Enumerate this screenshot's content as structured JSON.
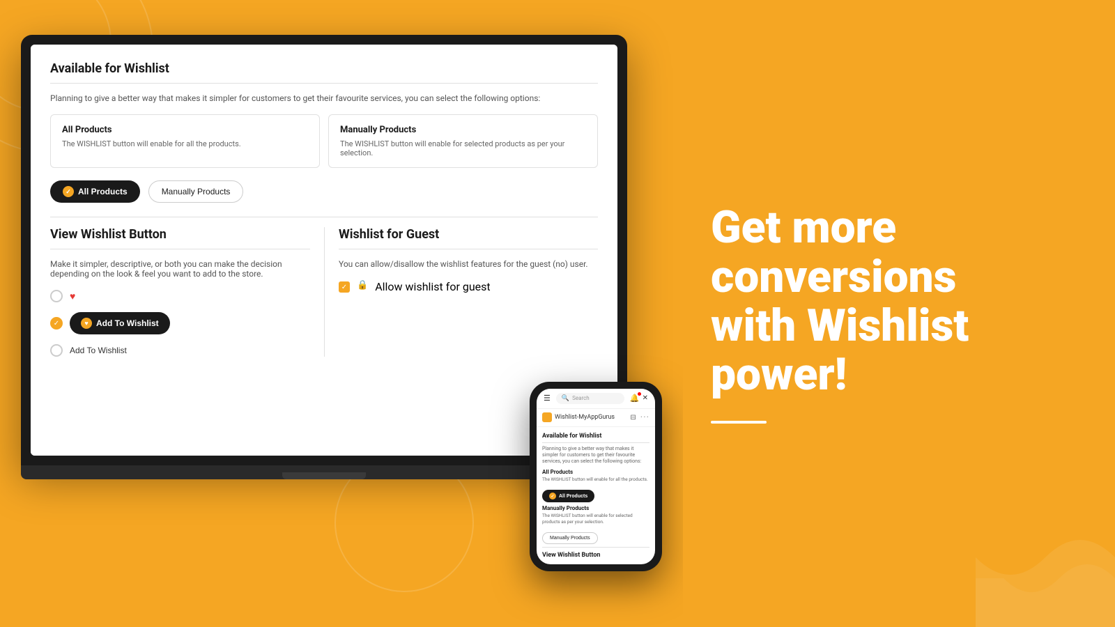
{
  "page": {
    "background_color": "#F5A623"
  },
  "laptop_screen": {
    "available_for_wishlist": {
      "title": "Available for Wishlist",
      "description": "Planning to give a better way that makes it simpler for customers to get their favourite services, you can select the following options:",
      "options": [
        {
          "title": "All Products",
          "description": "The WISHLIST button will enable for all the products."
        },
        {
          "title": "Manually Products",
          "description": "The WISHLIST button will enable for selected products as per your selection."
        }
      ],
      "btn_all_products": "All Products",
      "btn_manually_products": "Manually Products"
    },
    "view_wishlist_button": {
      "title": "View Wishlist Button",
      "description": "Make it simpler, descriptive, or both you can make the decision depending on the look & feel you want to add to the store.",
      "btn_add_to_wishlist": "Add To Wishlist",
      "btn_add_to_wishlist_text": "Add To Wishlist"
    },
    "wishlist_for_guest": {
      "title": "Wishlist for Guest",
      "description": "You can allow/disallow the wishlist features for the guest (no) user.",
      "allow_label": "Allow wishlist for guest"
    }
  },
  "phone_screen": {
    "search_placeholder": "Search",
    "app_name": "Wishlist-MyAppGurus",
    "available_for_wishlist": {
      "title": "Available for Wishlist",
      "description": "Planning to give a better way that makes it simpler for customers to get their favourite services, you can select the following options:",
      "all_products_title": "All Products",
      "all_products_desc": "The WISHLIST button will enable for all the products.",
      "btn_all_products": "All Products",
      "manually_products_title": "Manually Products",
      "manually_products_desc": "The WISHLIST button will enable for selected products as per your selection.",
      "btn_manually_products": "Manually Products"
    },
    "view_wishlist_title": "View Wishlist Button"
  },
  "right_section": {
    "tagline_line1": "Get more",
    "tagline_line2": "conversions",
    "tagline_line3": "with Wishlist",
    "tagline_line4": "power!"
  }
}
